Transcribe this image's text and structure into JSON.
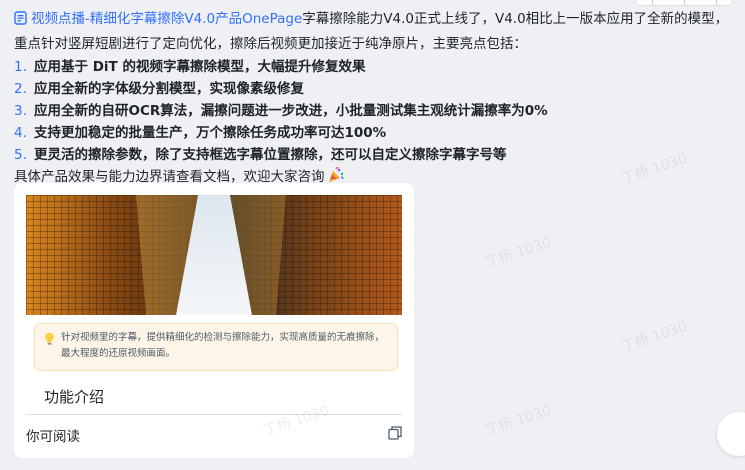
{
  "message": {
    "doc_link": "视频点播-精细化字幕擦除V4.0产品OnePage",
    "intro_rest": "字幕擦除能力V4.0正式上线了，V4.0相比上一版本应用了全新的模型，重点针对竖屏短剧进行了定向优化，擦除后视频更加接近于纯净原片，主要亮点包括：",
    "points": [
      {
        "num": "1.",
        "text": "应用基于 DiT 的视频字幕擦除模型，大幅提升修复效果"
      },
      {
        "num": "2.",
        "text": "应用全新的字体级分割模型，实现像素级修复"
      },
      {
        "num": "3.",
        "text": "应用全新的自研OCR算法，漏擦问题进一步改进，小批量测试集主观统计漏擦率为0%"
      },
      {
        "num": "4.",
        "text": "支持更加稳定的批量生产，万个擦除任务成功率可达100%"
      },
      {
        "num": "5.",
        "text": "更灵活的擦除参数，除了支持框选字幕位置擦除，还可以自定义擦除字幕字号等"
      }
    ],
    "outro": "具体产品效果与能力边界请查看文档，欢迎大家咨询"
  },
  "card": {
    "tip": "针对视频里的字幕，提供精细化的检测与擦除能力，实现高质量的无痕擦除，最大程度的还原视频画面。",
    "section_title": "功能介绍",
    "footer_text": "你可阅读"
  },
  "watermark": "丁杨 1030",
  "icons": {
    "doc": "doc-icon",
    "party": "party-popper-icon",
    "bulb": "light-bulb-icon",
    "copy": "copy-icon"
  },
  "colors": {
    "link": "#3370ff",
    "tip_bg": "#fdf6e8"
  }
}
